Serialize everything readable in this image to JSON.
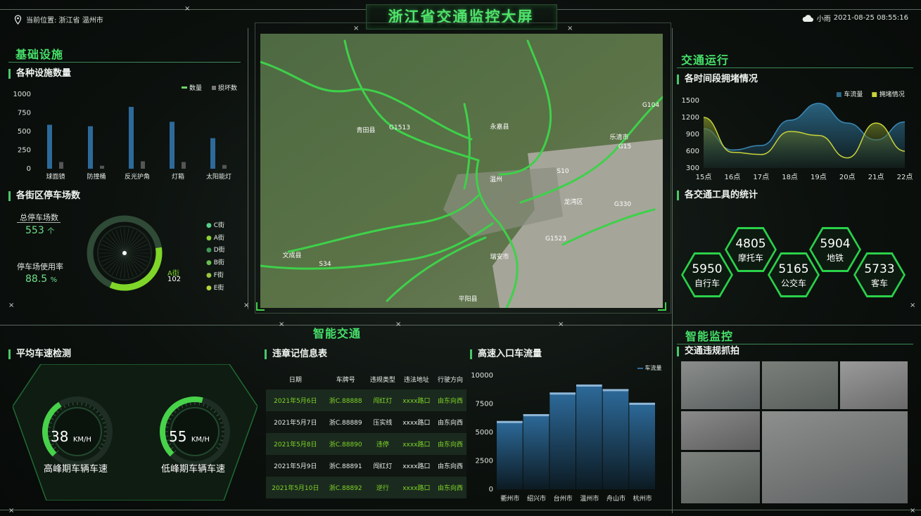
{
  "header": {
    "location_label": "当前位置: 浙江省 温州市",
    "title": "浙江省交通监控大屏",
    "weather": "小雨",
    "datetime": "2021-08-25 08:55:16"
  },
  "left": {
    "panel_title": "基础设施",
    "facilities": {
      "title": "各种设施数量",
      "legend": [
        "数量",
        "损坏数"
      ],
      "chart_data": {
        "type": "bar",
        "categories": [
          "球面镜",
          "防撞桶",
          "反光护角",
          "灯箱",
          "太阳能灯"
        ],
        "series": [
          {
            "name": "数量",
            "values": [
              590,
              570,
              830,
              630,
              410
            ]
          },
          {
            "name": "损坏数",
            "values": [
              90,
              40,
              100,
              90,
              50
            ]
          }
        ],
        "yticks": [
          "1000",
          "750",
          "500",
          "250",
          "0"
        ],
        "ylim": [
          0,
          1000
        ]
      }
    },
    "parking": {
      "title": "各街区停车场数",
      "total_label": "总停车场数",
      "total_value": "553",
      "total_unit": "个",
      "rate_label": "停车场使用率",
      "rate_value": "88.5",
      "rate_unit": "%",
      "ring_label": "A街",
      "ring_value": "102",
      "ring_fraction": 0.34,
      "legend": [
        "C街",
        "A街",
        "D街",
        "B街",
        "F街",
        "E街"
      ]
    }
  },
  "right": {
    "panel_title": "交通运行",
    "congestion": {
      "title": "各时间段拥堵情况",
      "legend": [
        "车流量",
        "拥堵情况"
      ],
      "chart_data": {
        "type": "area",
        "x": [
          "15点",
          "16点",
          "17点",
          "18点",
          "19点",
          "20点",
          "21点",
          "22点"
        ],
        "series": [
          {
            "name": "车流量",
            "values": [
              1000,
              620,
              700,
              1150,
              1450,
              1100,
              800,
              1120
            ]
          },
          {
            "name": "拥堵情况",
            "values": [
              1200,
              580,
              540,
              950,
              880,
              480,
              1100,
              600
            ]
          }
        ],
        "yticks": [
          "1500",
          "1200",
          "900",
          "600",
          "300"
        ],
        "ylim": [
          300,
          1500
        ]
      }
    },
    "transport": {
      "title": "各交通工具的统计",
      "items": [
        {
          "value": "4805",
          "label": "摩托车"
        },
        {
          "value": "5904",
          "label": "地铁"
        },
        {
          "value": "5950",
          "label": "自行车"
        },
        {
          "value": "5165",
          "label": "公交车"
        },
        {
          "value": "5733",
          "label": "客车"
        }
      ]
    }
  },
  "bottom": {
    "panel_title": "智能交通",
    "speed": {
      "title": "平均车速检测",
      "gauges": [
        {
          "value": "38",
          "unit": "KM/H",
          "label": "高峰期车辆车速",
          "fraction": 0.38
        },
        {
          "value": "55",
          "unit": "KM/H",
          "label": "低峰期车辆车速",
          "fraction": 0.55
        }
      ]
    },
    "violations": {
      "title": "违章记信息表",
      "columns": [
        "日期",
        "车牌号",
        "违规类型",
        "违法地址",
        "行驶方向"
      ],
      "rows": [
        [
          "2021年5月6日",
          "浙C.88888",
          "闯红灯",
          "xxxx路口",
          "由东向西"
        ],
        [
          "2021年5月7日",
          "浙C.88889",
          "压实线",
          "xxxx路口",
          "由东向西"
        ],
        [
          "2021年5月8日",
          "浙C.88890",
          "违停",
          "xxxx路口",
          "由东向西"
        ],
        [
          "2021年5月9日",
          "浙C.88891",
          "闯红灯",
          "xxxx路口",
          "由东向西"
        ],
        [
          "2021年5月10日",
          "浙C.88892",
          "逆行",
          "xxxx路口",
          "由东向西"
        ]
      ]
    },
    "highway": {
      "title": "高速入口车流量",
      "legend": [
        "车流量"
      ],
      "chart_data": {
        "type": "bar",
        "categories": [
          "衢州市",
          "绍兴市",
          "台州市",
          "温州市",
          "舟山市",
          "杭州市"
        ],
        "values": [
          6000,
          6600,
          8500,
          9200,
          8800,
          7600
        ],
        "yticks": [
          "10000",
          "7500",
          "5000",
          "2500",
          "0"
        ],
        "ylim": [
          0,
          10000
        ]
      }
    }
  },
  "monitor": {
    "panel_title": "智能监控",
    "section_title": "交通违规抓拍"
  },
  "map": {
    "labels": [
      "青田县",
      "永嘉县",
      "乐清市",
      "温州",
      "龙湾区",
      "瑞安市",
      "文成县",
      "平阳县",
      "G1513",
      "G104",
      "G15",
      "S10",
      "G330",
      "G1523",
      "S34"
    ]
  },
  "colors": {
    "accent": "#46e06a",
    "bar": "#2d6a9a",
    "congestion_line": "#c8d23a"
  }
}
